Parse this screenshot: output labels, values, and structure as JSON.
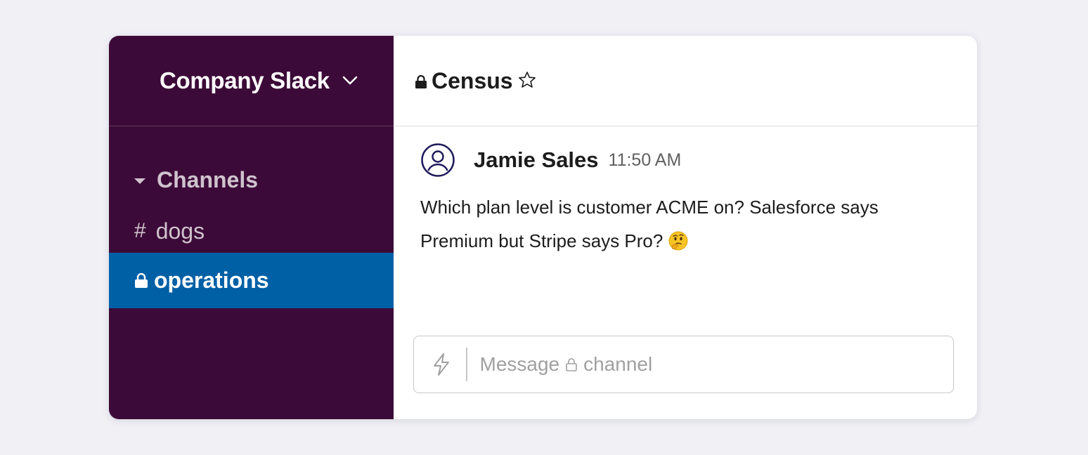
{
  "workspace": {
    "name": "Company Slack"
  },
  "sidebar": {
    "section_title": "Channels",
    "channels": [
      {
        "prefix": "#",
        "name": "dogs",
        "private": false,
        "selected": false
      },
      {
        "name": "operations",
        "private": true,
        "selected": true
      }
    ]
  },
  "channel": {
    "title": "Census",
    "private": true
  },
  "message": {
    "author": "Jamie Sales",
    "time": "11:50 AM",
    "text": "Which plan level is customer ACME on? Salesforce says Premium but Stripe says Pro?",
    "emoji": "thinking-face"
  },
  "composer": {
    "placeholder_prefix": "Message",
    "placeholder_suffix": "channel"
  },
  "colors": {
    "sidebar_bg": "#3c0a38",
    "selected_bg": "#0060a6",
    "avatar_stroke": "#1f1a5c"
  }
}
